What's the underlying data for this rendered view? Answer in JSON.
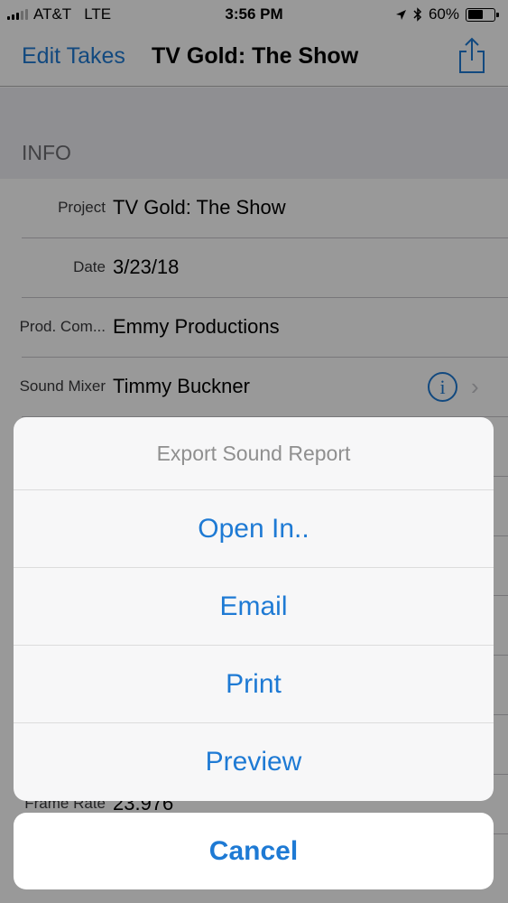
{
  "status_bar": {
    "carrier": "AT&T",
    "network": "LTE",
    "time": "3:56 PM",
    "battery": "60%",
    "battery_level": 0.6,
    "icons": [
      "signal-icon",
      "location-arrow-icon",
      "bluetooth-icon",
      "battery-icon"
    ]
  },
  "nav": {
    "back_label": "Edit Takes",
    "title": "TV Gold: The Show",
    "share_icon": "share-icon"
  },
  "info": {
    "section_title": "INFO",
    "rows": [
      {
        "label": "Project",
        "value": "TV Gold: The Show"
      },
      {
        "label": "Date",
        "value": "3/23/18"
      },
      {
        "label": "Prod. Com...",
        "value": "Emmy Productions"
      },
      {
        "label": "Sound Mixer",
        "value": "Timmy Buckner"
      }
    ],
    "partial_row": {
      "label": "Frame Rate",
      "value": "23.976"
    }
  },
  "action_sheet": {
    "title": "Export Sound Report",
    "items": [
      "Open In..",
      "Email",
      "Print",
      "Preview"
    ],
    "cancel": "Cancel"
  },
  "colors": {
    "accent": "#1e7ad4",
    "section_bg": "#efeff4"
  }
}
